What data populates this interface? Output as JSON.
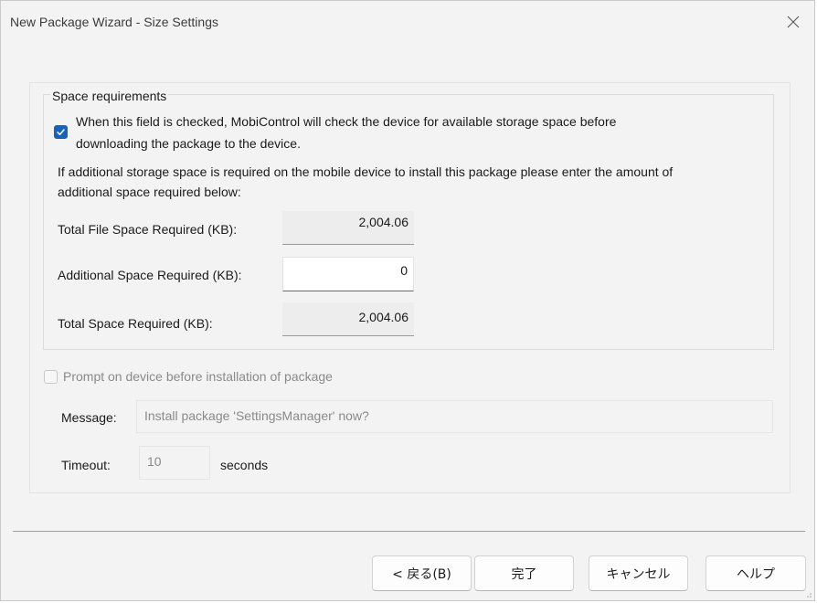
{
  "window": {
    "title": "New Package Wizard - Size Settings"
  },
  "space_requirements": {
    "group_title": "Space requirements",
    "check_storage": {
      "checked": true,
      "label_line1": "When this field is checked, MobiControl will check the device for available storage space before",
      "label_line2": "downloading the package to the device."
    },
    "info_line1": "If additional storage space is required on the mobile device to install this package please enter the amount of",
    "info_line2": "additional space required below:",
    "total_file_space": {
      "label": "Total File Space Required (KB):",
      "value": "2,004.06"
    },
    "additional_space": {
      "label": "Additional Space Required (KB):",
      "value": "0"
    },
    "total_space": {
      "label": "Total Space Required (KB):",
      "value": "2,004.06"
    }
  },
  "prompt": {
    "checked": false,
    "label": "Prompt on device before installation of package",
    "message_label": "Message:",
    "message_value": "Install package 'SettingsManager' now?",
    "timeout_label": "Timeout:",
    "timeout_value": "10",
    "seconds_label": "seconds"
  },
  "buttons": {
    "back": "< 戻る(B)",
    "finish": "完了",
    "cancel": "キャンセル",
    "help": "ヘルプ"
  },
  "colors": {
    "accent": "#1a62b8",
    "window_bg": "#f3f3f3"
  }
}
